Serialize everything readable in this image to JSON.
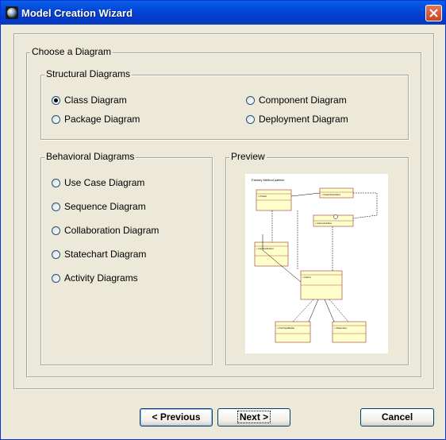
{
  "window": {
    "title": "Model Creation Wizard"
  },
  "choose": {
    "label": "Choose a Diagram",
    "structural": {
      "label": "Structural Diagrams",
      "options": [
        "Class Diagram",
        "Package Diagram",
        "Component Diagram",
        "Deployment Diagram"
      ],
      "selected": "Class Diagram"
    },
    "behavioral": {
      "label": "Behavioral Diagrams",
      "options": [
        "Use Case Diagram",
        "Sequence Diagram",
        "Collaboration Diagram",
        "Statechart Diagram",
        "Activity Diagrams"
      ]
    },
    "preview": {
      "label": "Preview",
      "diagram_title": "Factory Method pattern"
    }
  },
  "buttons": {
    "previous": "< Previous",
    "next": "Next >",
    "cancel": "Cancel"
  },
  "colors": {
    "titlebar": "#0347d8",
    "close": "#c84323",
    "class_fill": "#ffffcc",
    "class_border": "#993333"
  }
}
